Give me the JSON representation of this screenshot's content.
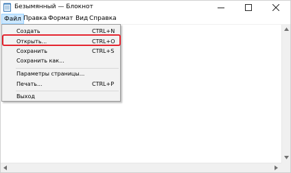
{
  "window": {
    "title": "Безымянный — Блокнот",
    "buttons": {
      "minimize": "—",
      "maximize": "☐",
      "close": "✕"
    }
  },
  "menubar": {
    "items": [
      "Файл",
      "Правка",
      "Формат",
      "Вид",
      "Справка"
    ],
    "active": "Файл"
  },
  "file_menu": {
    "items": [
      {
        "label": "Создать",
        "shortcut": "CTRL+N"
      },
      {
        "label": "Открыть...",
        "shortcut": "CTRL+O"
      },
      {
        "label": "Сохранить",
        "shortcut": "CTRL+S"
      },
      {
        "label": "Сохранить как...",
        "shortcut": ""
      },
      {
        "label": "Параметры страницы...",
        "shortcut": ""
      },
      {
        "label": "Печать...",
        "shortcut": "CTRL+P"
      },
      {
        "label": "Выход",
        "shortcut": ""
      }
    ],
    "highlighted": "Открыть..."
  },
  "colors": {
    "active_menu_bg": "#cce8ff",
    "highlight_border": "#e4232d",
    "menu_bg": "#f2f2f2"
  },
  "icons": [
    "notepad-icon",
    "minimize-icon",
    "maximize-icon",
    "close-icon",
    "scroll-up-arrow-icon",
    "scroll-down-arrow-icon",
    "scroll-left-arrow-icon",
    "scroll-right-arrow-icon"
  ]
}
